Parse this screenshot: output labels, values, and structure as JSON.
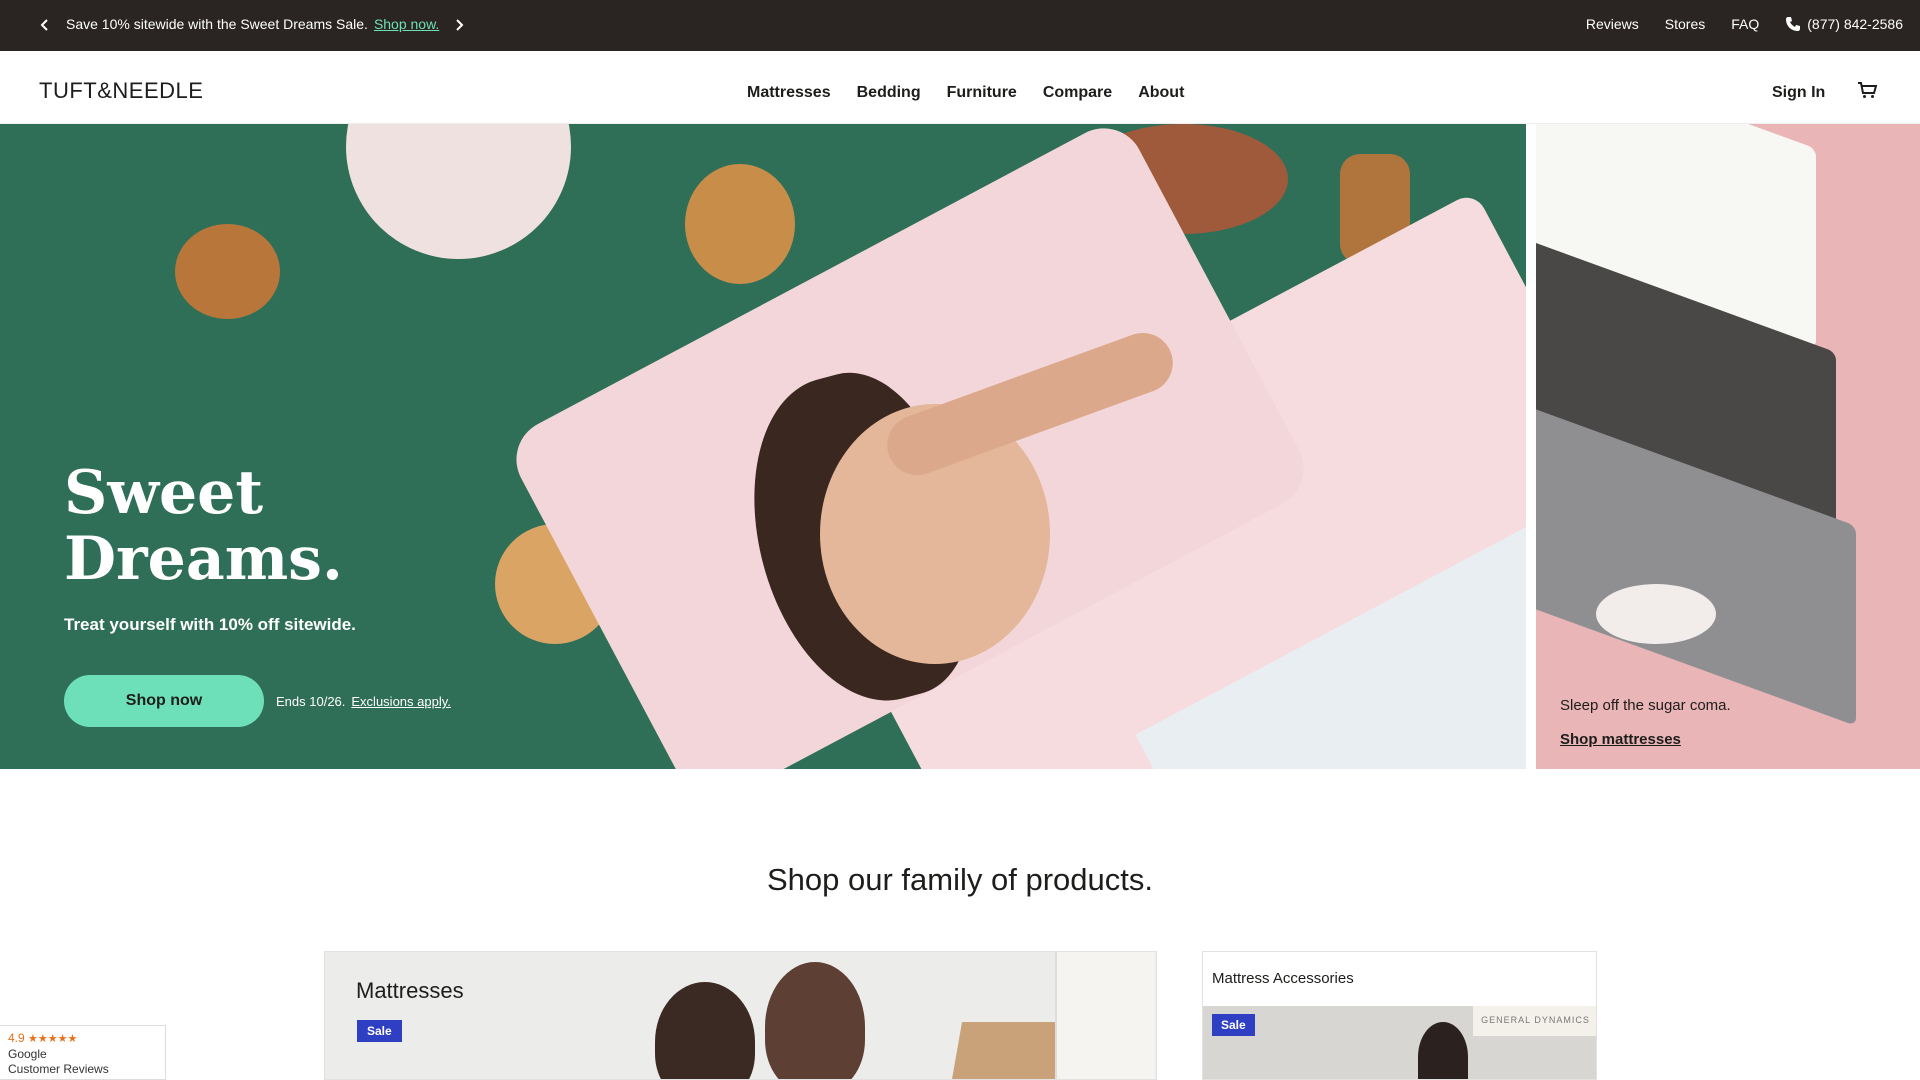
{
  "promo_bar": {
    "message": "Save 10% sitewide with the Sweet Dreams Sale.",
    "message_link": "Shop now.",
    "links": [
      "Reviews",
      "Stores",
      "FAQ"
    ],
    "phone": "(877) 842-2586",
    "link_color": "#6ee0b9"
  },
  "header": {
    "logo": "TUFT&NEEDLE",
    "nav": [
      "Mattresses",
      "Bedding",
      "Furniture",
      "Compare",
      "About"
    ],
    "sign_in": "Sign In"
  },
  "hero": {
    "title_line1": "Sweet",
    "title_line2": "Dreams.",
    "subtitle": "Treat yourself with 10% off sitewide.",
    "button": "Shop now",
    "ends": "Ends 10/26.",
    "exclusions": "Exclusions apply.",
    "bg_color": "#2f6f58",
    "button_color": "#6ee0b9"
  },
  "side_promo": {
    "text": "Sleep off the sugar coma.",
    "link": "Shop mattresses",
    "bg_color": "#eab5b7"
  },
  "products": {
    "title": "Shop our family of products.",
    "cards": [
      {
        "title": "Mattresses",
        "badge": "Sale"
      },
      {
        "title": "Mattress Accessories",
        "badge": "Sale",
        "poster_text": "GENERAL DYNAMICS"
      }
    ],
    "badge_color": "#2f3fc4"
  },
  "google_badge": {
    "score": "4.9",
    "stars": "★★★★★",
    "line1": "Google",
    "line2": "Customer Reviews"
  }
}
